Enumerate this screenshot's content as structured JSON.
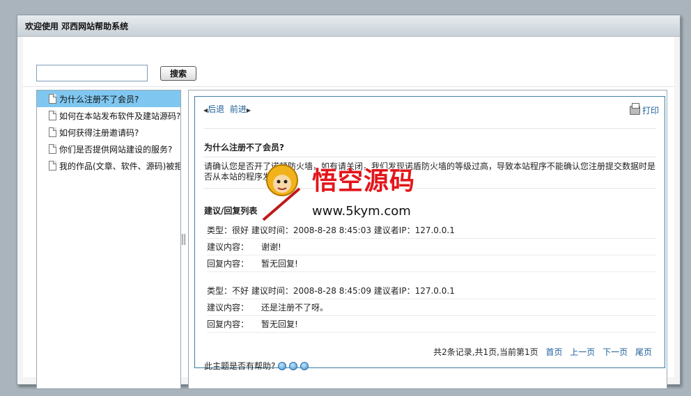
{
  "window": {
    "title": "欢迎使用 邓西网站帮助系统"
  },
  "search": {
    "placeholder": "",
    "button_label": "搜索"
  },
  "sidebar": {
    "items": [
      {
        "label": "为什么注册不了会员?"
      },
      {
        "label": "如何在本站发布软件及建站源码?"
      },
      {
        "label": "如何获得注册邀请码?"
      },
      {
        "label": "你们是否提供网站建设的服务?"
      },
      {
        "label": "我的作品(文章、软件、源码)被拒绝了?"
      }
    ]
  },
  "nav": {
    "back": "后退",
    "forward": "前进",
    "print": "打印"
  },
  "article": {
    "title": "为什么注册不了会员?",
    "answer": "请确认您是否开了诺顿防火墙，如有请关闭，我们发现诺盾防火墙的等级过高，导致本站程序不能确认您注册提交数据时是否从本站的程序发出。"
  },
  "replies": {
    "title": "建议/回复列表",
    "items": [
      {
        "meta": "类型：很好  建议时间：2008-8-28 8:45:03 建议者IP：127.0.0.1",
        "suggest_label": "建议内容：",
        "suggest": "谢谢!",
        "reply_label": "回复内容：",
        "reply": "暂无回复!"
      },
      {
        "meta": "类型：不好  建议时间：2008-8-28 8:45:09 建议者IP：127.0.0.1",
        "suggest_label": "建议内容：",
        "suggest": "还是注册不了呀。",
        "reply_label": "回复内容：",
        "reply": "暂无回复!"
      }
    ]
  },
  "pager": {
    "summary": "共2条记录,共1页,当前第1页",
    "first": "首页",
    "prev": "上一页",
    "next": "下一页",
    "last": "尾页"
  },
  "feedback": {
    "question": "此主题是否有帮助?"
  },
  "watermark": {
    "name": "悟空源码",
    "url": "www.5kym.com"
  }
}
